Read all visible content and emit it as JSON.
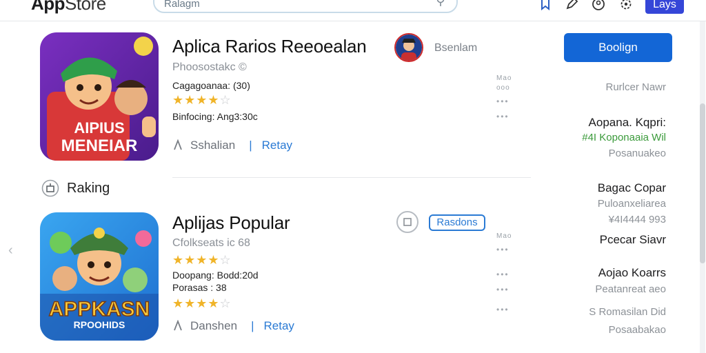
{
  "header": {
    "brand_bold": "App",
    "brand_light": "Store",
    "search_placeholder": "Ralagm",
    "button_label": "Lays"
  },
  "apps": [
    {
      "title": "Aplica Rarios Reeoealan",
      "subtitle": "Phoosostakc ©",
      "category": "Cagagoanaa: (30)",
      "rating_stars": 4,
      "rating_max": 5,
      "info": "Binfocing: Ang3:30c",
      "action_left": "Sshalian",
      "action_right": "Retay",
      "publisher": "Bsenlam",
      "icon_text": [
        "AIPIUS",
        "MENEIAR"
      ],
      "mini_label": "Mao",
      "mini_label2": "ooo"
    },
    {
      "title": "Aplijas Popular",
      "subtitle": "Cfolkseats ic 68",
      "rating_stars": 4,
      "rating_max": 5,
      "info": "Doopang: Bodd:20d",
      "info2": "Porasas : 38",
      "action_left": "Danshen",
      "action_right": "Retay",
      "tag_label": "Rasdons",
      "icon_text": [
        "APPKASN",
        "RPOOHIDS"
      ],
      "mini_label": "Mao"
    }
  ],
  "section": {
    "label": "Raking"
  },
  "right_column": {
    "primary_button": "Boolign",
    "lines": [
      {
        "text": "Rurlcer Nawr",
        "style": "gray"
      },
      {
        "text": "Aopana. Kqpri:",
        "style": "dark"
      },
      {
        "text": "#4I Koponaaia Wil",
        "style": "green"
      },
      {
        "text": "Posanuakeo",
        "style": "gray"
      },
      {
        "text": "Bagac Copar",
        "style": "dark"
      },
      {
        "text": "Puloanxeliarea",
        "style": "gray"
      },
      {
        "text": "¥4I4444 993",
        "style": "gray"
      },
      {
        "text": "Pcecar Siavr",
        "style": "dark"
      },
      {
        "text": "Aojao Koarrs",
        "style": "dark"
      },
      {
        "text": "Peatanreat aeo",
        "style": "gray"
      },
      {
        "text": "S Romasilan Did",
        "style": "gray"
      },
      {
        "text": "Posaabakao",
        "style": "gray"
      }
    ]
  },
  "colors": {
    "accent_blue": "#1366d6",
    "header_button": "#3546d8",
    "star": "#f0b429",
    "green": "#3a9a3a"
  }
}
